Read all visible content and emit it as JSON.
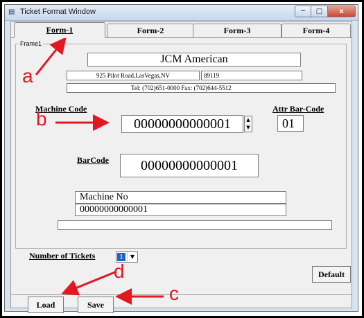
{
  "window": {
    "title": "Ticket Format Window",
    "controls": {
      "minimize": "─",
      "maximize": "□",
      "close": "x"
    }
  },
  "tabs": [
    {
      "label": "Form-1",
      "active": true
    },
    {
      "label": "Form-2",
      "active": false
    },
    {
      "label": "Form-3",
      "active": false
    },
    {
      "label": "Form-4",
      "active": false
    }
  ],
  "frame": {
    "label": "Frame1",
    "company": "JCM American",
    "address": "925 Pilot Road,LasVegas,NV",
    "zip": "89119",
    "phone": "Tel: (702)651-0000  Fax: (702)644-5512"
  },
  "machine_code": {
    "label": "Machine Code",
    "value": "00000000000001"
  },
  "attr_barcode": {
    "label": "Attr Bar-Code",
    "value": "01"
  },
  "barcode": {
    "label": "BarCode",
    "value": "00000000000001"
  },
  "machine_no": {
    "label_value": "Machine No",
    "value": "00000000000001",
    "extra": ""
  },
  "tickets": {
    "label": "Number of Tickets",
    "value": "1"
  },
  "buttons": {
    "default": "Default",
    "load": "Load",
    "save": "Save"
  },
  "callouts": {
    "a": "a",
    "b": "b",
    "c": "c",
    "d": "d"
  },
  "colors": {
    "callout": "#e3171f",
    "selection": "#1d64c8"
  }
}
